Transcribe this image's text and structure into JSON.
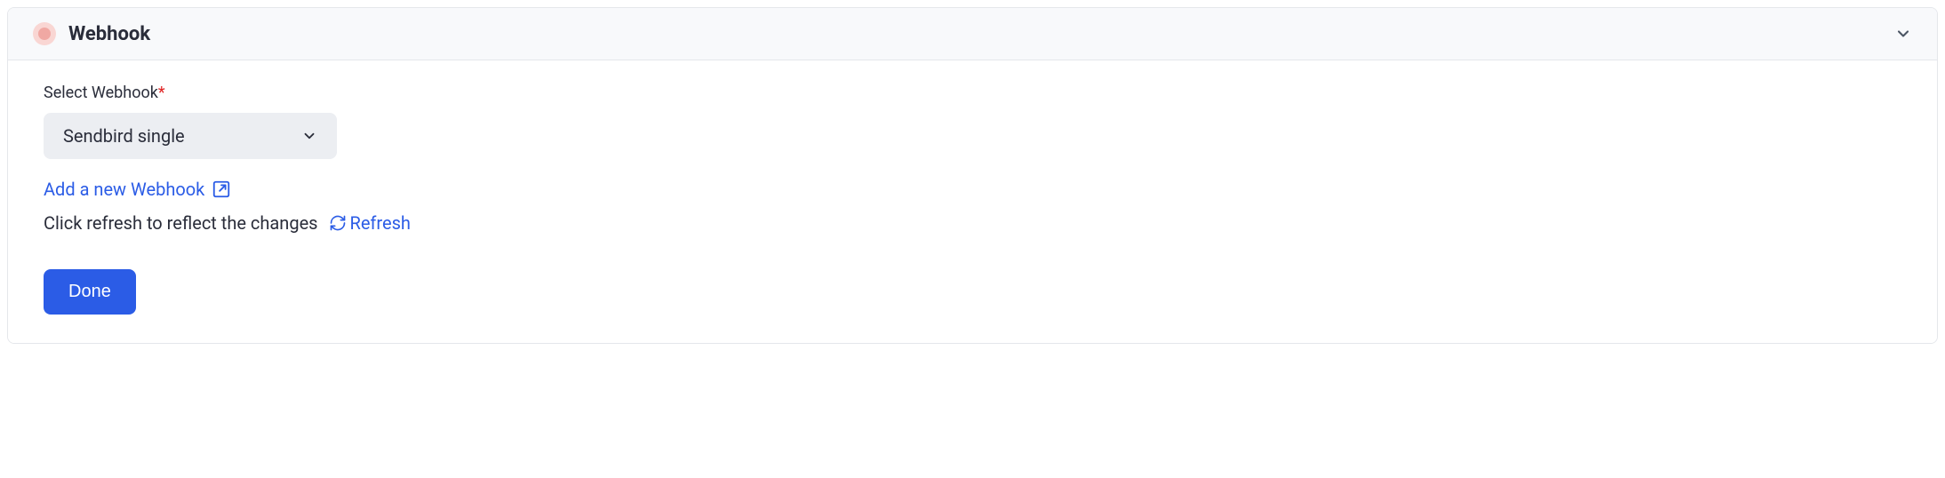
{
  "header": {
    "title": "Webhook"
  },
  "form": {
    "label": "Select Webhook",
    "required_mark": "*",
    "select_value": "Sendbird single",
    "add_link": "Add a new Webhook",
    "helper_text": "Click refresh to reflect the changes",
    "refresh_label": "Refresh",
    "done_label": "Done"
  }
}
